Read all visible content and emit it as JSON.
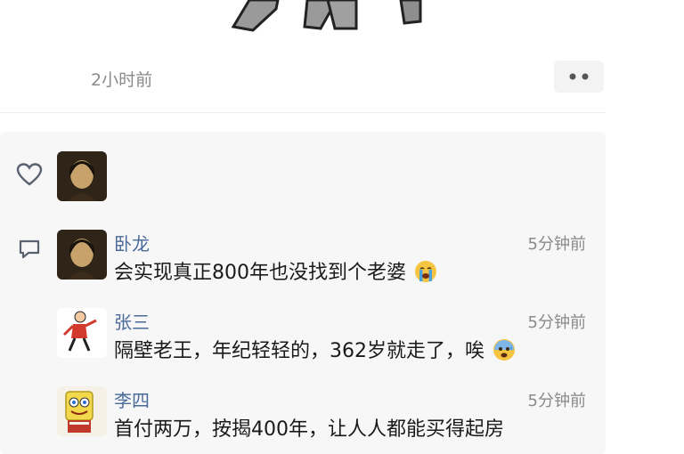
{
  "post": {
    "time": "2小时前",
    "more_icon": "more-dots-icon"
  },
  "likes": {
    "icon": "heart-icon",
    "avatars": [
      {
        "icon": "portrait-avatar"
      }
    ]
  },
  "comments_icon": "comment-bubble-icon",
  "comments": [
    {
      "name": "卧龙",
      "time": "5分钟前",
      "text": "会实现真正800年也没找到个老婆",
      "emoji": "crying-face-emoji",
      "avatar": "portrait-avatar"
    },
    {
      "name": "张三",
      "time": "5分钟前",
      "text": "隔壁老王，年纪轻轻的，362岁就走了，唉",
      "emoji": "anxious-face-emoji",
      "avatar": "cartoon-figure-avatar"
    },
    {
      "name": "李四",
      "time": "5分钟前",
      "text": "首付两万，按揭400年，让人人都能买得起房",
      "emoji": "",
      "avatar": "sponge-character-avatar"
    }
  ],
  "colors": {
    "name": "#4a6a9a",
    "muted": "#8a8a8a",
    "panel_bg": "#f7f7f8"
  }
}
